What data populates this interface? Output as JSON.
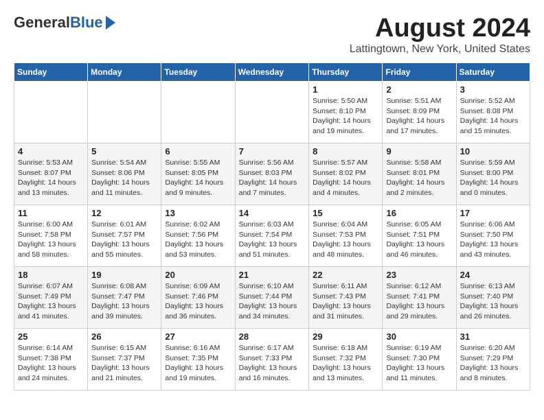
{
  "logo": {
    "general": "General",
    "blue": "Blue"
  },
  "title": {
    "month_year": "August 2024",
    "location": "Lattingtown, New York, United States"
  },
  "weekdays": [
    "Sunday",
    "Monday",
    "Tuesday",
    "Wednesday",
    "Thursday",
    "Friday",
    "Saturday"
  ],
  "weeks": [
    [
      {
        "day": "",
        "info": ""
      },
      {
        "day": "",
        "info": ""
      },
      {
        "day": "",
        "info": ""
      },
      {
        "day": "",
        "info": ""
      },
      {
        "day": "1",
        "info": "Sunrise: 5:50 AM\nSunset: 8:10 PM\nDaylight: 14 hours\nand 19 minutes."
      },
      {
        "day": "2",
        "info": "Sunrise: 5:51 AM\nSunset: 8:09 PM\nDaylight: 14 hours\nand 17 minutes."
      },
      {
        "day": "3",
        "info": "Sunrise: 5:52 AM\nSunset: 8:08 PM\nDaylight: 14 hours\nand 15 minutes."
      }
    ],
    [
      {
        "day": "4",
        "info": "Sunrise: 5:53 AM\nSunset: 8:07 PM\nDaylight: 14 hours\nand 13 minutes."
      },
      {
        "day": "5",
        "info": "Sunrise: 5:54 AM\nSunset: 8:06 PM\nDaylight: 14 hours\nand 11 minutes."
      },
      {
        "day": "6",
        "info": "Sunrise: 5:55 AM\nSunset: 8:05 PM\nDaylight: 14 hours\nand 9 minutes."
      },
      {
        "day": "7",
        "info": "Sunrise: 5:56 AM\nSunset: 8:03 PM\nDaylight: 14 hours\nand 7 minutes."
      },
      {
        "day": "8",
        "info": "Sunrise: 5:57 AM\nSunset: 8:02 PM\nDaylight: 14 hours\nand 4 minutes."
      },
      {
        "day": "9",
        "info": "Sunrise: 5:58 AM\nSunset: 8:01 PM\nDaylight: 14 hours\nand 2 minutes."
      },
      {
        "day": "10",
        "info": "Sunrise: 5:59 AM\nSunset: 8:00 PM\nDaylight: 14 hours\nand 0 minutes."
      }
    ],
    [
      {
        "day": "11",
        "info": "Sunrise: 6:00 AM\nSunset: 7:58 PM\nDaylight: 13 hours\nand 58 minutes."
      },
      {
        "day": "12",
        "info": "Sunrise: 6:01 AM\nSunset: 7:57 PM\nDaylight: 13 hours\nand 55 minutes."
      },
      {
        "day": "13",
        "info": "Sunrise: 6:02 AM\nSunset: 7:56 PM\nDaylight: 13 hours\nand 53 minutes."
      },
      {
        "day": "14",
        "info": "Sunrise: 6:03 AM\nSunset: 7:54 PM\nDaylight: 13 hours\nand 51 minutes."
      },
      {
        "day": "15",
        "info": "Sunrise: 6:04 AM\nSunset: 7:53 PM\nDaylight: 13 hours\nand 48 minutes."
      },
      {
        "day": "16",
        "info": "Sunrise: 6:05 AM\nSunset: 7:51 PM\nDaylight: 13 hours\nand 46 minutes."
      },
      {
        "day": "17",
        "info": "Sunrise: 6:06 AM\nSunset: 7:50 PM\nDaylight: 13 hours\nand 43 minutes."
      }
    ],
    [
      {
        "day": "18",
        "info": "Sunrise: 6:07 AM\nSunset: 7:49 PM\nDaylight: 13 hours\nand 41 minutes."
      },
      {
        "day": "19",
        "info": "Sunrise: 6:08 AM\nSunset: 7:47 PM\nDaylight: 13 hours\nand 39 minutes."
      },
      {
        "day": "20",
        "info": "Sunrise: 6:09 AM\nSunset: 7:46 PM\nDaylight: 13 hours\nand 36 minutes."
      },
      {
        "day": "21",
        "info": "Sunrise: 6:10 AM\nSunset: 7:44 PM\nDaylight: 13 hours\nand 34 minutes."
      },
      {
        "day": "22",
        "info": "Sunrise: 6:11 AM\nSunset: 7:43 PM\nDaylight: 13 hours\nand 31 minutes."
      },
      {
        "day": "23",
        "info": "Sunrise: 6:12 AM\nSunset: 7:41 PM\nDaylight: 13 hours\nand 29 minutes."
      },
      {
        "day": "24",
        "info": "Sunrise: 6:13 AM\nSunset: 7:40 PM\nDaylight: 13 hours\nand 26 minutes."
      }
    ],
    [
      {
        "day": "25",
        "info": "Sunrise: 6:14 AM\nSunset: 7:38 PM\nDaylight: 13 hours\nand 24 minutes."
      },
      {
        "day": "26",
        "info": "Sunrise: 6:15 AM\nSunset: 7:37 PM\nDaylight: 13 hours\nand 21 minutes."
      },
      {
        "day": "27",
        "info": "Sunrise: 6:16 AM\nSunset: 7:35 PM\nDaylight: 13 hours\nand 19 minutes."
      },
      {
        "day": "28",
        "info": "Sunrise: 6:17 AM\nSunset: 7:33 PM\nDaylight: 13 hours\nand 16 minutes."
      },
      {
        "day": "29",
        "info": "Sunrise: 6:18 AM\nSunset: 7:32 PM\nDaylight: 13 hours\nand 13 minutes."
      },
      {
        "day": "30",
        "info": "Sunrise: 6:19 AM\nSunset: 7:30 PM\nDaylight: 13 hours\nand 11 minutes."
      },
      {
        "day": "31",
        "info": "Sunrise: 6:20 AM\nSunset: 7:29 PM\nDaylight: 13 hours\nand 8 minutes."
      }
    ]
  ]
}
